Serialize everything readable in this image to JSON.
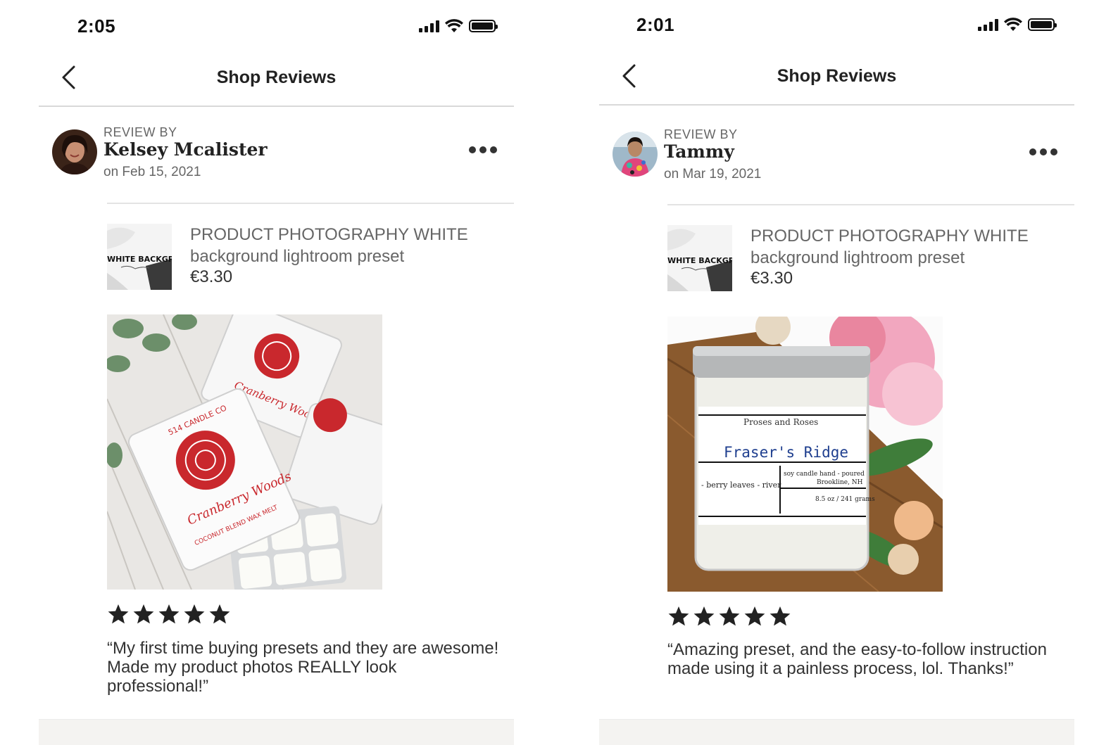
{
  "screens": [
    {
      "status": {
        "time": "2:05"
      },
      "nav": {
        "title": "Shop Reviews"
      },
      "reviewer": {
        "review_by": "REVIEW BY",
        "name": "Kelsey Mcalister",
        "date": "on Feb 15, 2021"
      },
      "product": {
        "title_line1": "PRODUCT PHOTOGRAPHY WHITE",
        "title_line2": "background lightroom preset",
        "price": "€3.30",
        "thumb_text": "WHITE BACKGROUND"
      },
      "photo": {
        "brand": "514 CANDLE CO",
        "scent": "Cranberry Woods",
        "sub": "COCONUT BLEND WAX MELT"
      },
      "rating": 5,
      "review_text": "“My first time buying presets and they are awesome! Made my product photos REALLY look professional!”"
    },
    {
      "status": {
        "time": "2:01"
      },
      "nav": {
        "title": "Shop Reviews"
      },
      "reviewer": {
        "review_by": "REVIEW BY",
        "name": "Tammy",
        "date": "on Mar 19, 2021"
      },
      "product": {
        "title_line1": "PRODUCT PHOTOGRAPHY WHITE",
        "title_line2": "background lightroom preset",
        "price": "€3.30",
        "thumb_text": "WHITE BACKGROUND"
      },
      "photo": {
        "brand": "Proses and Roses",
        "scent": "Fraser's Ridge",
        "notes": "- berry leaves - river",
        "desc": "soy candle hand - poured",
        "place": "Brookline, NH",
        "weight": "8.5 oz / 241 grams"
      },
      "rating": 5,
      "review_text": "“Amazing preset, and the easy-to-follow instruction made using it a painless process, lol. Thanks!”"
    }
  ],
  "colors": {
    "star": "#222222",
    "divider": "#e3e3e3",
    "muted_text": "#666666"
  },
  "icons": [
    "back-chevron-icon",
    "more-options-icon",
    "star-icon",
    "signal-icon",
    "wifi-icon",
    "battery-icon"
  ]
}
